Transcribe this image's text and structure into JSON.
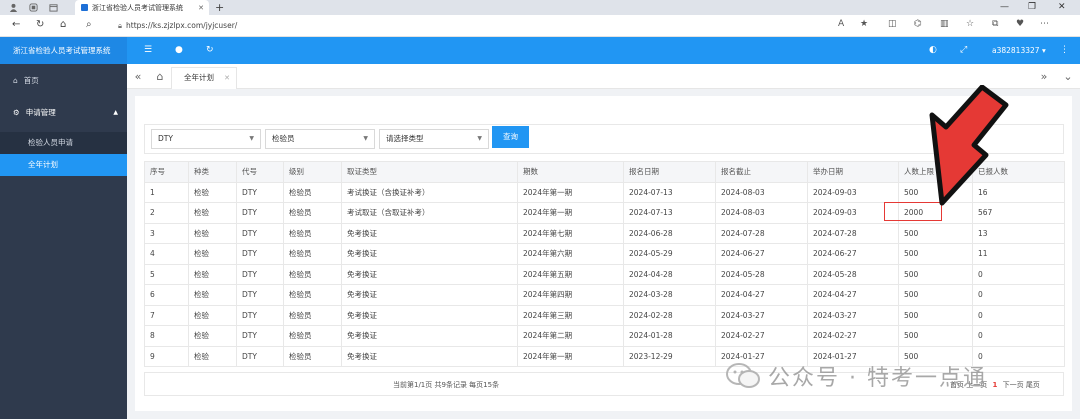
{
  "browser": {
    "tab_title": "浙江省检验人员考试管理系统",
    "url": "https://ks.zjzlpx.com/jyjcuser/"
  },
  "app": {
    "name": "浙江省检验人员考试管理系统",
    "user": "a382813327"
  },
  "sidebar": {
    "home": "首页",
    "group": "申请管理",
    "items": [
      "检验人员申请",
      "全年计划"
    ]
  },
  "page_tab": "全年计划",
  "filters": {
    "type": "DTY",
    "level": "检验员",
    "cert_type_placeholder": "请选择类型",
    "query_button": "查询"
  },
  "table": {
    "headers": [
      "序号",
      "种类",
      "代号",
      "级别",
      "取证类型",
      "期数",
      "报名日期",
      "报名截止",
      "举办日期",
      "人数上限",
      "已报人数"
    ],
    "rows": [
      [
        "1",
        "检验",
        "DTY",
        "检验员",
        "考试换证（含换证补考）",
        "2024年第一期",
        "2024-07-13",
        "2024-08-03",
        "2024-09-03",
        "500",
        "16"
      ],
      [
        "2",
        "检验",
        "DTY",
        "检验员",
        "考试取证（含取证补考）",
        "2024年第一期",
        "2024-07-13",
        "2024-08-03",
        "2024-09-03",
        "2000",
        "567"
      ],
      [
        "3",
        "检验",
        "DTY",
        "检验员",
        "免考换证",
        "2024年第七期",
        "2024-06-28",
        "2024-07-28",
        "2024-07-28",
        "500",
        "13"
      ],
      [
        "4",
        "检验",
        "DTY",
        "检验员",
        "免考换证",
        "2024年第六期",
        "2024-05-29",
        "2024-06-27",
        "2024-06-27",
        "500",
        "11"
      ],
      [
        "5",
        "检验",
        "DTY",
        "检验员",
        "免考换证",
        "2024年第五期",
        "2024-04-28",
        "2024-05-28",
        "2024-05-28",
        "500",
        "0"
      ],
      [
        "6",
        "检验",
        "DTY",
        "检验员",
        "免考换证",
        "2024年第四期",
        "2024-03-28",
        "2024-04-27",
        "2024-04-27",
        "500",
        "0"
      ],
      [
        "7",
        "检验",
        "DTY",
        "检验员",
        "免考换证",
        "2024年第三期",
        "2024-02-28",
        "2024-03-27",
        "2024-03-27",
        "500",
        "0"
      ],
      [
        "8",
        "检验",
        "DTY",
        "检验员",
        "免考换证",
        "2024年第二期",
        "2024-01-28",
        "2024-02-27",
        "2024-02-27",
        "500",
        "0"
      ],
      [
        "9",
        "检验",
        "DTY",
        "检验员",
        "免考换证",
        "2024年第一期",
        "2023-12-29",
        "2024-01-27",
        "2024-01-27",
        "500",
        "0"
      ]
    ]
  },
  "pager": {
    "info": "当前第1/1页 共9条记录 每页15条",
    "first": "首页",
    "prev": "上一页",
    "current": "1",
    "next": "下一页",
    "last": "尾页"
  },
  "watermark": "公众号 · 特考一点通",
  "colors": {
    "primary": "#2196f3",
    "sidebar": "#2f3a4d",
    "annotation": "#e53935"
  }
}
